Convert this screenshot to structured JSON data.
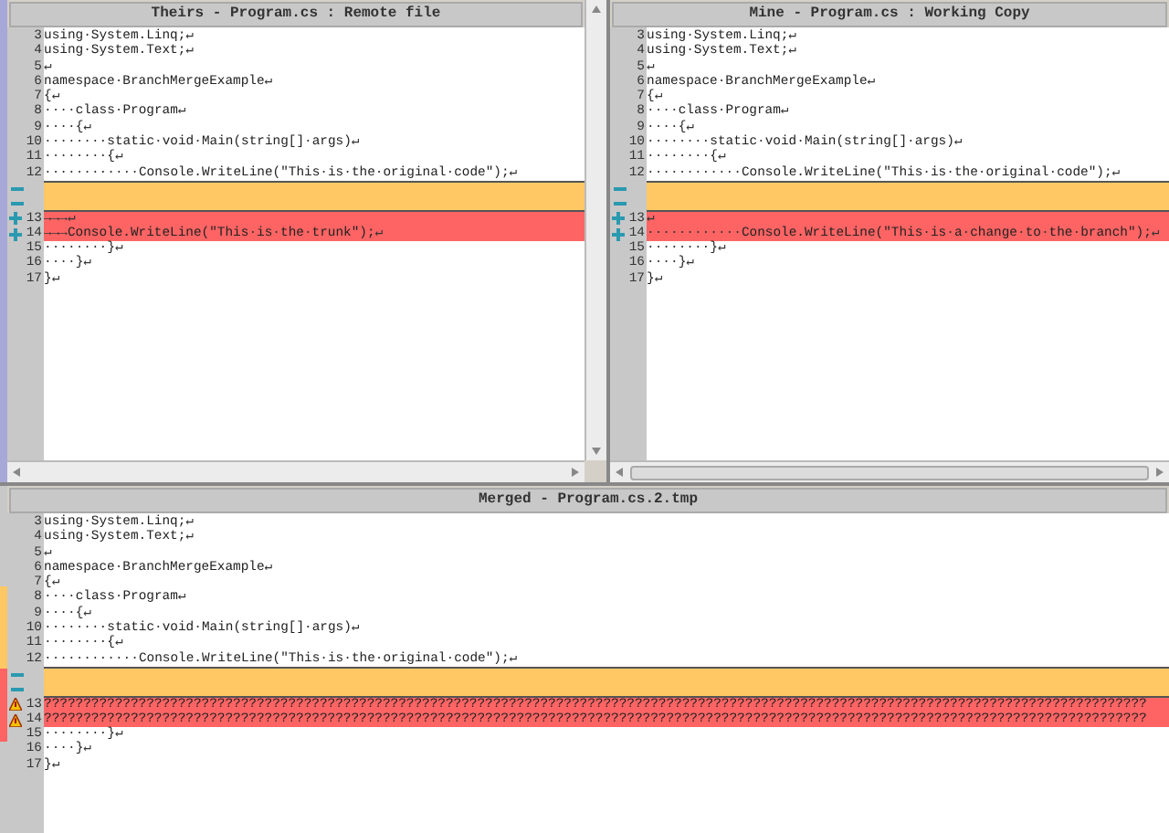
{
  "panes": [
    {
      "title": "Theirs - Program.cs : Remote file",
      "lines": [
        {
          "number": "3",
          "text": "using·System.Linq;↵",
          "kind": "normal"
        },
        {
          "number": "4",
          "text": "using·System.Text;↵",
          "kind": "normal"
        },
        {
          "number": "5",
          "text": "↵",
          "kind": "normal"
        },
        {
          "number": "6",
          "text": "namespace·BranchMergeExample↵",
          "kind": "normal"
        },
        {
          "number": "7",
          "text": "{↵",
          "kind": "normal"
        },
        {
          "number": "8",
          "text": "····class·Program↵",
          "kind": "normal"
        },
        {
          "number": "9",
          "text": "····{↵",
          "kind": "normal"
        },
        {
          "number": "10",
          "text": "········static·void·Main(string[]·args)↵",
          "kind": "normal"
        },
        {
          "number": "11",
          "text": "········{↵",
          "kind": "normal"
        },
        {
          "number": "12",
          "text": "············Console.WriteLine(\"This·is·the·original·code\");↵",
          "kind": "normal"
        },
        {
          "kind": "empty"
        },
        {
          "kind": "empty"
        },
        {
          "number": "13",
          "text": "→→→↵",
          "kind": "added"
        },
        {
          "number": "14",
          "text": "→→→Console.WriteLine(\"This·is·the·trunk\");↵",
          "kind": "added"
        },
        {
          "number": "15",
          "text": "········}↵",
          "kind": "normal"
        },
        {
          "number": "16",
          "text": "····}↵",
          "kind": "normal"
        },
        {
          "number": "17",
          "text": "}↵",
          "kind": "normal"
        }
      ]
    },
    {
      "title": "Mine - Program.cs : Working Copy",
      "lines": [
        {
          "number": "3",
          "text": "using·System.Linq;↵",
          "kind": "normal"
        },
        {
          "number": "4",
          "text": "using·System.Text;↵",
          "kind": "normal"
        },
        {
          "number": "5",
          "text": "↵",
          "kind": "normal"
        },
        {
          "number": "6",
          "text": "namespace·BranchMergeExample↵",
          "kind": "normal"
        },
        {
          "number": "7",
          "text": "{↵",
          "kind": "normal"
        },
        {
          "number": "8",
          "text": "····class·Program↵",
          "kind": "normal"
        },
        {
          "number": "9",
          "text": "····{↵",
          "kind": "normal"
        },
        {
          "number": "10",
          "text": "········static·void·Main(string[]·args)↵",
          "kind": "normal"
        },
        {
          "number": "11",
          "text": "········{↵",
          "kind": "normal"
        },
        {
          "number": "12",
          "text": "············Console.WriteLine(\"This·is·the·original·code\");↵",
          "kind": "normal"
        },
        {
          "kind": "empty"
        },
        {
          "kind": "empty"
        },
        {
          "number": "13",
          "text": "↵",
          "kind": "added"
        },
        {
          "number": "14",
          "text": "············Console.WriteLine(\"This·is·a·change·to·the·branch\");↵",
          "kind": "added"
        },
        {
          "number": "15",
          "text": "········}↵",
          "kind": "normal"
        },
        {
          "number": "16",
          "text": "····}↵",
          "kind": "normal"
        },
        {
          "number": "17",
          "text": "}↵",
          "kind": "normal"
        }
      ]
    },
    {
      "title": "Merged - Program.cs.2.tmp",
      "lines": [
        {
          "number": "3",
          "text": "using·System.Linq;↵",
          "kind": "normal"
        },
        {
          "number": "4",
          "text": "using·System.Text;↵",
          "kind": "normal"
        },
        {
          "number": "5",
          "text": "↵",
          "kind": "normal"
        },
        {
          "number": "6",
          "text": "namespace·BranchMergeExample↵",
          "kind": "normal"
        },
        {
          "number": "7",
          "text": "{↵",
          "kind": "normal"
        },
        {
          "number": "8",
          "text": "····class·Program↵",
          "kind": "normal"
        },
        {
          "number": "9",
          "text": "····{↵",
          "kind": "normal"
        },
        {
          "number": "10",
          "text": "········static·void·Main(string[]·args)↵",
          "kind": "normal"
        },
        {
          "number": "11",
          "text": "········{↵",
          "kind": "normal"
        },
        {
          "number": "12",
          "text": "············Console.WriteLine(\"This·is·the·original·code\");↵",
          "kind": "normal"
        },
        {
          "kind": "empty"
        },
        {
          "kind": "empty"
        },
        {
          "number": "13",
          "text": "????????????????????????????????????????????????????????????????????????????????????????????????????????????????????????????????????????????",
          "kind": "conflict"
        },
        {
          "number": "14",
          "text": "????????????????????????????????????????????????????????????????????????????????????????????????????????????????????????????????????????????",
          "kind": "conflict"
        },
        {
          "number": "15",
          "text": "········}↵",
          "kind": "normal"
        },
        {
          "number": "16",
          "text": "····}↵",
          "kind": "normal"
        },
        {
          "number": "17",
          "text": "}↵",
          "kind": "normal"
        }
      ]
    }
  ]
}
